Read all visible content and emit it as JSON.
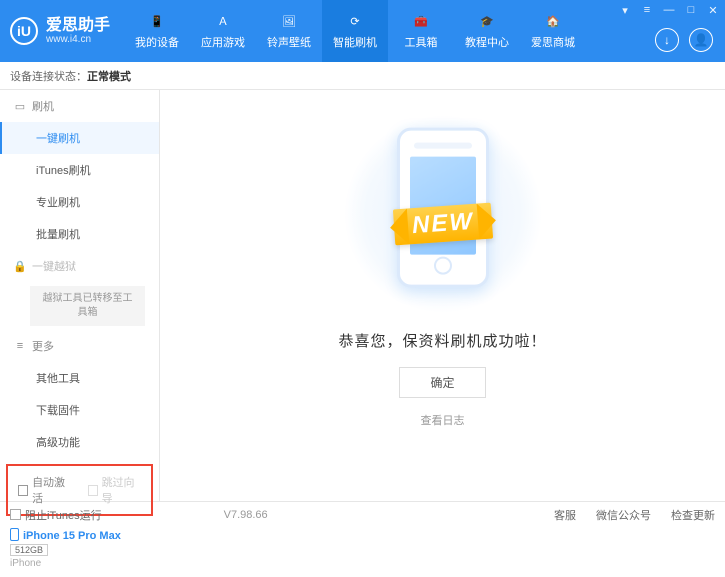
{
  "app": {
    "name": "爱思助手",
    "url": "www.i4.cn",
    "logo_letter": "iU"
  },
  "win": {
    "menu": "▾",
    "tray": "≡",
    "min": "—",
    "max": "□",
    "close": "✕"
  },
  "nav": [
    {
      "label": "我的设备",
      "icon": "📱"
    },
    {
      "label": "应用游戏",
      "icon": "Ａ"
    },
    {
      "label": "铃声壁纸",
      "icon": "🖼"
    },
    {
      "label": "智能刷机",
      "icon": "⟳",
      "active": true
    },
    {
      "label": "工具箱",
      "icon": "🧰"
    },
    {
      "label": "教程中心",
      "icon": "🎓"
    },
    {
      "label": "爱思商城",
      "icon": "🏠"
    }
  ],
  "right_icons": {
    "download": "↓",
    "user": "👤"
  },
  "status": {
    "label": "设备连接状态：",
    "value": "正常模式"
  },
  "sidebar": {
    "group1": {
      "label": "刷机",
      "icon": "▭"
    },
    "items1": [
      "一键刷机",
      "iTunes刷机",
      "专业刷机",
      "批量刷机"
    ],
    "group2": {
      "label": "一键越狱",
      "icon": "🔒"
    },
    "block": "越狱工具已转移至工具箱",
    "group3": {
      "label": "更多",
      "icon": "≡"
    },
    "items3": [
      "其他工具",
      "下载固件",
      "高级功能"
    ],
    "checks": {
      "auto_activate": "自动激活",
      "skip_guide": "跳过向导"
    },
    "device": {
      "name": "iPhone 15 Pro Max",
      "storage": "512GB",
      "type": "iPhone"
    }
  },
  "main": {
    "ribbon": "NEW",
    "message": "恭喜您，保资料刷机成功啦！",
    "ok": "确定",
    "log": "查看日志"
  },
  "footer": {
    "block_itunes": "阻止iTunes运行",
    "version": "V7.98.66",
    "links": [
      "客服",
      "微信公众号",
      "检查更新"
    ]
  }
}
